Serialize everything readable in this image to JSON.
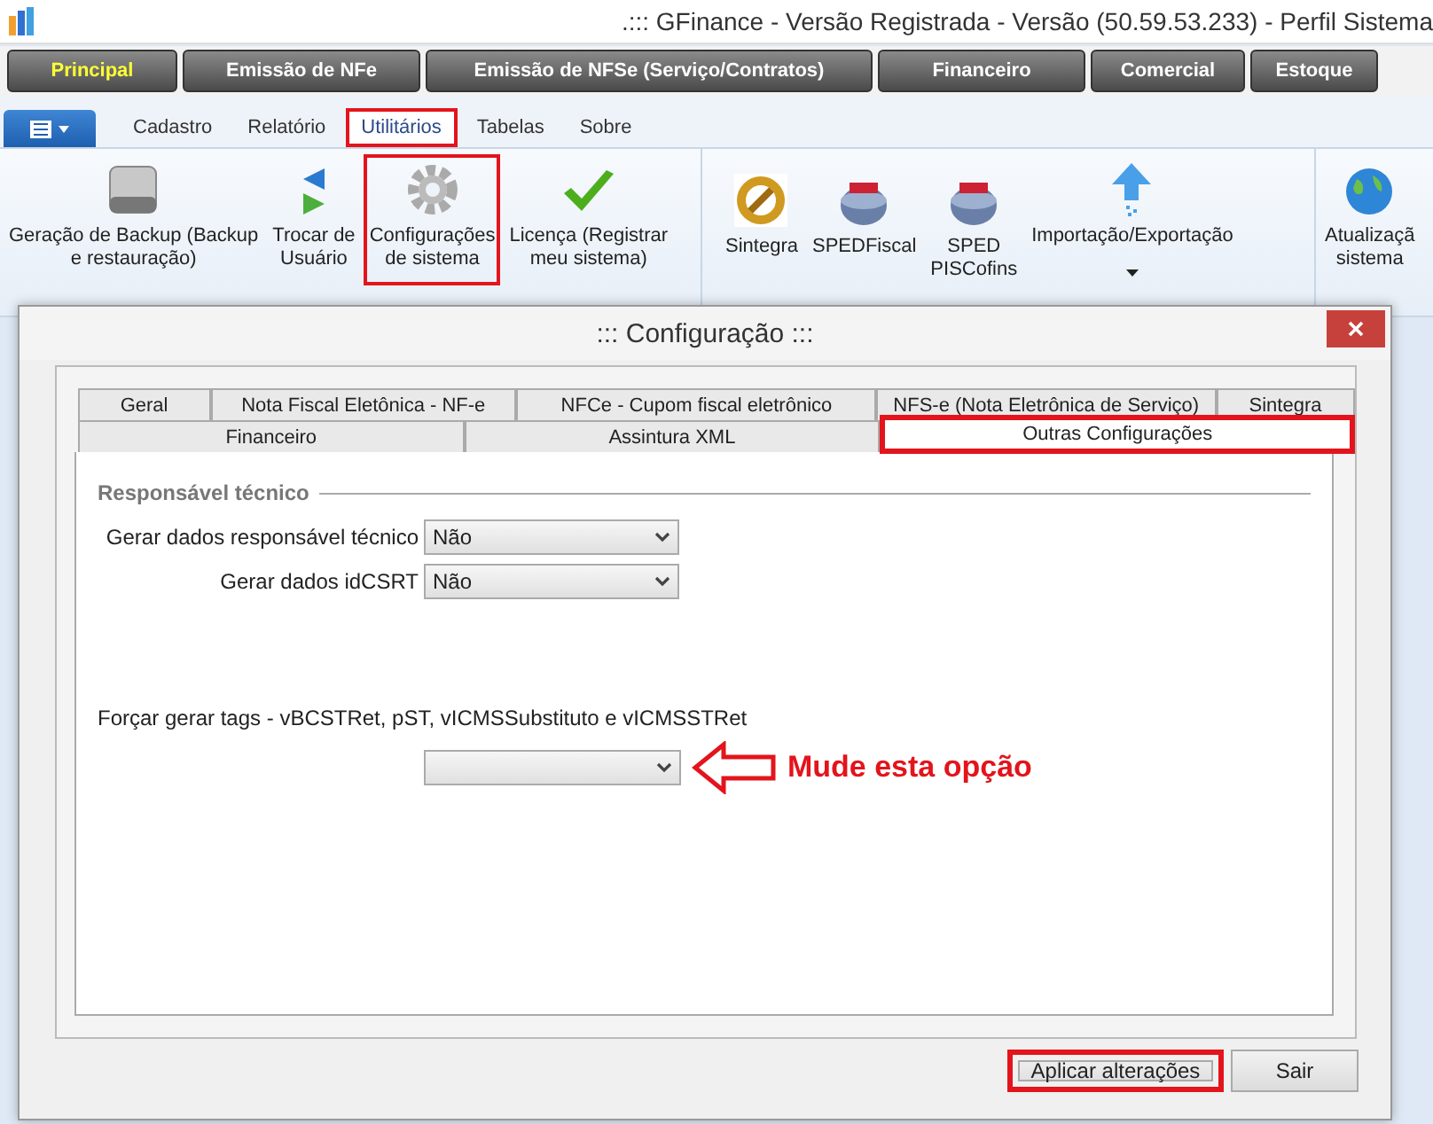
{
  "window": {
    "title": ".::: GFinance - Versão Registrada - Versão  (50.59.53.233) - Perfil Sistema"
  },
  "nav_buttons": [
    {
      "label": "Principal",
      "selected": true
    },
    {
      "label": "Emissão de NFe",
      "selected": false
    },
    {
      "label": "Emissão de NFSe (Serviço/Contratos)",
      "selected": false
    },
    {
      "label": "Financeiro",
      "selected": false
    },
    {
      "label": "Comercial",
      "selected": false
    },
    {
      "label": "Estoque",
      "selected": false
    }
  ],
  "ribbon_tabs": [
    {
      "label": "Cadastro",
      "selected": false,
      "highlighted": false
    },
    {
      "label": "Relatório",
      "selected": false,
      "highlighted": false
    },
    {
      "label": "Utilitários",
      "selected": true,
      "highlighted": true
    },
    {
      "label": "Tabelas",
      "selected": false,
      "highlighted": false
    },
    {
      "label": "Sobre",
      "selected": false,
      "highlighted": false
    }
  ],
  "ribbon_groups": [
    {
      "buttons": [
        {
          "kind": "drive",
          "lines": [
            "Geração de Backup (Backup",
            "e restauração)"
          ],
          "highlighted": false
        },
        {
          "kind": "swap",
          "lines": [
            "Trocar de",
            "Usuário"
          ],
          "highlighted": false
        },
        {
          "kind": "gear",
          "lines": [
            "Configurações",
            "de sistema"
          ],
          "highlighted": true
        },
        {
          "kind": "check",
          "lines": [
            "Licença (Registrar",
            "meu sistema)"
          ],
          "highlighted": false
        }
      ]
    },
    {
      "buttons": [
        {
          "kind": "sintegra",
          "lines": [
            "Sintegra"
          ],
          "highlighted": false
        },
        {
          "kind": "sped",
          "lines": [
            "SPEDFiscal"
          ],
          "highlighted": false
        },
        {
          "kind": "sped",
          "lines": [
            "SPED",
            "PISCofins"
          ],
          "highlighted": false
        },
        {
          "kind": "upload",
          "lines": [
            "Importação/Exportação"
          ],
          "highlighted": false,
          "dropdown": true
        }
      ]
    },
    {
      "buttons": [
        {
          "kind": "globe",
          "lines": [
            "Atualizaçã",
            "sistema"
          ],
          "highlighted": false
        }
      ]
    }
  ],
  "dialog": {
    "title": "::: Configuração :::",
    "tab_rows": [
      [
        {
          "label": "Geral",
          "selected": false,
          "highlighted": false
        },
        {
          "label": "Nota Fiscal Eletônica - NF-e",
          "selected": false,
          "highlighted": false
        },
        {
          "label": "NFCe - Cupom fiscal eletrônico",
          "selected": false,
          "highlighted": false
        },
        {
          "label": "NFS-e  (Nota Eletrônica de Serviço)",
          "selected": false,
          "highlighted": false
        },
        {
          "label": "Sintegra",
          "selected": false,
          "highlighted": false
        }
      ],
      [
        {
          "label": "Financeiro",
          "selected": false,
          "highlighted": false
        },
        {
          "label": "Assintura XML",
          "selected": false,
          "highlighted": false
        },
        {
          "label": "Outras Configurações",
          "selected": true,
          "highlighted": true
        }
      ]
    ],
    "section_title": "Responsável técnico",
    "fields": [
      {
        "label": "Gerar dados responsável técnico",
        "value": "Não"
      },
      {
        "label": "Gerar dados idCSRT",
        "value": "Não"
      }
    ],
    "force_field": {
      "label": "Forçar gerar tags - vBCSTRet, pST, vICMSSubstituto e vICMSSTRet"
    },
    "callout": "Mude esta opção",
    "buttons": [
      {
        "label": "Aplicar alterações",
        "highlighted": true
      },
      {
        "label": "Sair",
        "highlighted": false
      }
    ]
  }
}
